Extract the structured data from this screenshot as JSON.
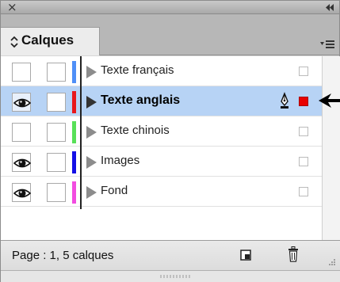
{
  "titlebar": {
    "close_glyph": "×",
    "collapse_icon": "double-chevron-left-icon"
  },
  "tab": {
    "label": "Calques",
    "arrows_icon": "up-down-arrows-icon"
  },
  "menu_icon": "panel-menu-icon",
  "layers": [
    {
      "name": "Texte français",
      "color": "#4f8ff7",
      "visible": false,
      "locked": false,
      "selected": false
    },
    {
      "name": "Texte anglais",
      "color": "#e8161b",
      "visible": true,
      "locked": false,
      "selected": true
    },
    {
      "name": "Texte chinois",
      "color": "#58e058",
      "visible": false,
      "locked": false,
      "selected": false
    },
    {
      "name": "Images",
      "color": "#1410e6",
      "visible": true,
      "locked": false,
      "selected": false
    },
    {
      "name": "Fond",
      "color": "#f24ce0",
      "visible": true,
      "locked": false,
      "selected": false
    }
  ],
  "footer": {
    "status": "Page : 1, 5 calques"
  },
  "colors": {
    "selection": "#b7d3f5",
    "selected_square": "#e80000"
  }
}
